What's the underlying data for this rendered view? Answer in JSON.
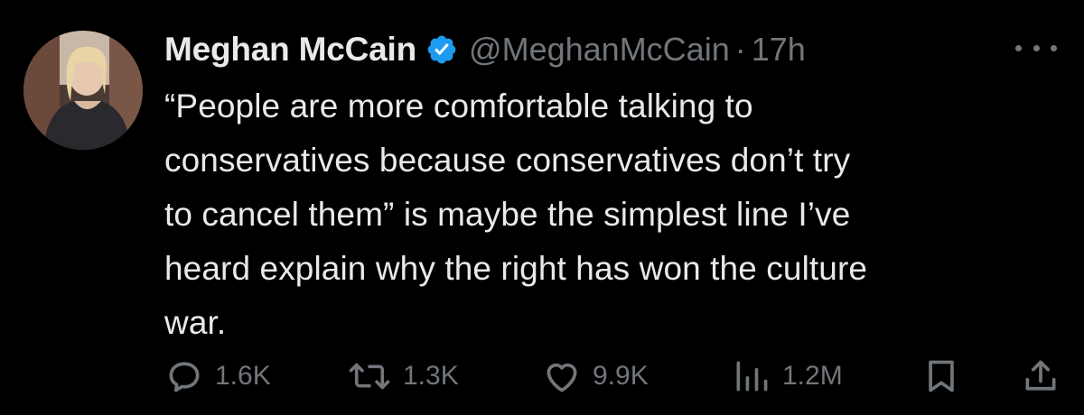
{
  "author": {
    "display_name": "Meghan McCain",
    "handle": "@MeghanMcCain",
    "separator": "·",
    "time": "17h",
    "verified": true,
    "verified_color": "#1d9bf0"
  },
  "tweet": {
    "lines": [
      "“People are more comfortable talking to",
      "conservatives because conservatives don’t try",
      "to cancel them” is maybe the simplest line I’ve",
      "heard explain why the right has won the culture",
      "war."
    ]
  },
  "actions": {
    "replies": "1.6K",
    "retweets": "1.3K",
    "likes": "9.9K",
    "views": "1.2M"
  },
  "icons": {
    "more": "more-dots-icon",
    "reply": "reply-icon",
    "retweet": "retweet-icon",
    "like": "heart-icon",
    "views": "views-chart-icon",
    "bookmark": "bookmark-icon",
    "share": "share-icon"
  },
  "colors": {
    "background": "#000000",
    "primary_text": "#e7e9ea",
    "secondary_text": "#71767b"
  }
}
